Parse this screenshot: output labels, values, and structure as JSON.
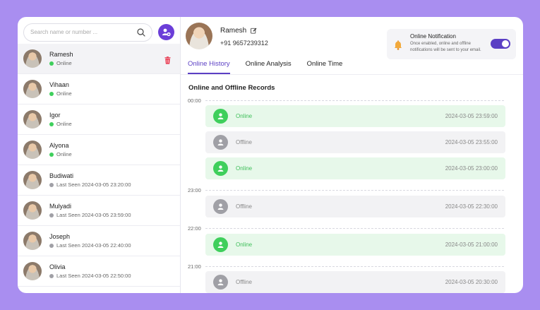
{
  "colors": {
    "accent": "#5b3fc4",
    "online": "#3fcf5c",
    "offline": "#a0a0a6",
    "background": "#a98ef0",
    "delete": "#e8334a"
  },
  "search": {
    "placeholder": "Search name or number ..."
  },
  "contacts": [
    {
      "name": "Ramesh",
      "status": "Online",
      "online": true
    },
    {
      "name": "Vihaan",
      "status": "Online",
      "online": true
    },
    {
      "name": "Igor",
      "status": "Online",
      "online": true
    },
    {
      "name": "Alyona",
      "status": "Online",
      "online": true
    },
    {
      "name": "Budiwati",
      "status": "Last Seen 2024-03-05 23:20:00",
      "online": false
    },
    {
      "name": "Mulyadi",
      "status": "Last Seen 2024-03-05 23:59:00",
      "online": false
    },
    {
      "name": "Joseph",
      "status": "Last Seen 2024-03-05 22:40:00",
      "online": false
    },
    {
      "name": "Olivia",
      "status": "Last Seen 2024-03-05 22:50:00",
      "online": false
    }
  ],
  "profile": {
    "name": "Ramesh",
    "phone": "+91 9657239312"
  },
  "notification": {
    "title": "Online Notification",
    "description": "Once enabled, online and offline notifications will be sent to your email.",
    "enabled": true
  },
  "tabs": [
    "Online History",
    "Online Analysis",
    "Online Time"
  ],
  "records_title": "Online and Offline Records",
  "time_markers": [
    "00:00",
    "23:00",
    "22:00",
    "21:00"
  ],
  "records": [
    {
      "status": "Online",
      "time": "2024-03-05 23:59:00",
      "online": true
    },
    {
      "status": "Offline",
      "time": "2024-03-05 23:55:00",
      "online": false
    },
    {
      "status": "Online",
      "time": "2024-03-05 23:00:00",
      "online": true
    },
    {
      "status": "Offline",
      "time": "2024-03-05 22:30:00",
      "online": false
    },
    {
      "status": "Online",
      "time": "2024-03-05 21:00:00",
      "online": true
    },
    {
      "status": "Offline",
      "time": "2024-03-05 20:30:00",
      "online": false
    }
  ]
}
